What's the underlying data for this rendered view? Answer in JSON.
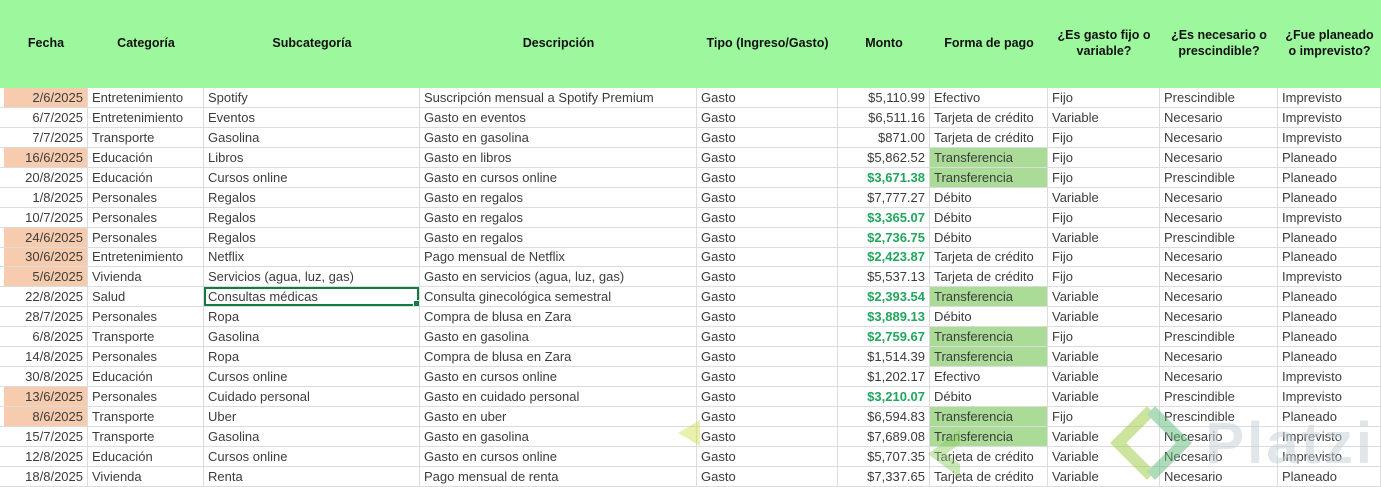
{
  "colors": {
    "header_bg": "#9df79d",
    "date_highlight_orange": "#f7ccae",
    "payment_highlight_green": "#aadb97",
    "amount_text_green": "#21a75d",
    "selection_border_green": "#107c41",
    "grid_line": "#dcdcdc",
    "watermark_text": "#c3cfd7",
    "watermark_logo_green": "#9ccb3f"
  },
  "watermark": {
    "brand": "Platzi"
  },
  "table": {
    "headers": [
      "Fecha",
      "Categoría",
      "Subcategoría",
      "Descripción",
      "Tipo (Ingreso/Gasto)",
      "Monto",
      "Forma de pago",
      "¿Es gasto fijo o variable?",
      "¿Es necesario o prescindible?",
      "¿Fue planeado o imprevisto?"
    ],
    "rows": [
      {
        "fecha": "2/6/2025",
        "fecha_hl": true,
        "categoria": "Entretenimiento",
        "subcategoria": "Spotify",
        "descripcion": "Suscripción mensual a Spotify Premium",
        "tipo": "Gasto",
        "monto": "$5,110.99",
        "monto_green": false,
        "pago": "Efectivo",
        "pago_hl": false,
        "fijo": "Fijo",
        "necesario": "Prescindible",
        "planeado": "Imprevisto"
      },
      {
        "fecha": "6/7/2025",
        "fecha_hl": false,
        "categoria": "Entretenimiento",
        "subcategoria": "Eventos",
        "descripcion": "Gasto en eventos",
        "tipo": "Gasto",
        "monto": "$6,511.16",
        "monto_green": false,
        "pago": "Tarjeta de crédito",
        "pago_hl": false,
        "fijo": "Variable",
        "necesario": "Necesario",
        "planeado": "Imprevisto"
      },
      {
        "fecha": "7/7/2025",
        "fecha_hl": false,
        "categoria": "Transporte",
        "subcategoria": "Gasolina",
        "descripcion": "Gasto en gasolina",
        "tipo": "Gasto",
        "monto": "$871.00",
        "monto_green": false,
        "pago": "Tarjeta de crédito",
        "pago_hl": false,
        "fijo": "Fijo",
        "necesario": "Necesario",
        "planeado": "Imprevisto"
      },
      {
        "fecha": "16/6/2025",
        "fecha_hl": true,
        "categoria": "Educación",
        "subcategoria": "Libros",
        "descripcion": "Gasto en libros",
        "tipo": "Gasto",
        "monto": "$5,862.52",
        "monto_green": false,
        "pago": "Transferencia",
        "pago_hl": true,
        "fijo": "Fijo",
        "necesario": "Necesario",
        "planeado": "Planeado"
      },
      {
        "fecha": "20/8/2025",
        "fecha_hl": false,
        "categoria": "Educación",
        "subcategoria": "Cursos online",
        "descripcion": "Gasto en cursos online",
        "tipo": "Gasto",
        "monto": "$3,671.38",
        "monto_green": true,
        "pago": "Transferencia",
        "pago_hl": true,
        "fijo": "Fijo",
        "necesario": "Prescindible",
        "planeado": "Planeado"
      },
      {
        "fecha": "1/8/2025",
        "fecha_hl": false,
        "categoria": "Personales",
        "subcategoria": "Regalos",
        "descripcion": "Gasto en regalos",
        "tipo": "Gasto",
        "monto": "$7,777.27",
        "monto_green": false,
        "pago": "Débito",
        "pago_hl": false,
        "fijo": "Variable",
        "necesario": "Necesario",
        "planeado": "Planeado"
      },
      {
        "fecha": "10/7/2025",
        "fecha_hl": false,
        "categoria": "Personales",
        "subcategoria": "Regalos",
        "descripcion": "Gasto en regalos",
        "tipo": "Gasto",
        "monto": "$3,365.07",
        "monto_green": true,
        "pago": "Débito",
        "pago_hl": false,
        "fijo": "Fijo",
        "necesario": "Necesario",
        "planeado": "Imprevisto"
      },
      {
        "fecha": "24/6/2025",
        "fecha_hl": true,
        "categoria": "Personales",
        "subcategoria": "Regalos",
        "descripcion": "Gasto en regalos",
        "tipo": "Gasto",
        "monto": "$2,736.75",
        "monto_green": true,
        "pago": "Débito",
        "pago_hl": false,
        "fijo": "Variable",
        "necesario": "Prescindible",
        "planeado": "Planeado"
      },
      {
        "fecha": "30/6/2025",
        "fecha_hl": true,
        "categoria": "Entretenimiento",
        "subcategoria": "Netflix",
        "descripcion": "Pago mensual de Netflix",
        "tipo": "Gasto",
        "monto": "$2,423.87",
        "monto_green": true,
        "pago": "Tarjeta de crédito",
        "pago_hl": false,
        "fijo": "Fijo",
        "necesario": "Necesario",
        "planeado": "Planeado"
      },
      {
        "fecha": "5/6/2025",
        "fecha_hl": true,
        "categoria": "Vivienda",
        "subcategoria": "Servicios (agua, luz, gas)",
        "descripcion": "Gasto en servicios (agua, luz, gas)",
        "tipo": "Gasto",
        "monto": "$5,537.13",
        "monto_green": false,
        "pago": "Tarjeta de crédito",
        "pago_hl": false,
        "fijo": "Fijo",
        "necesario": "Necesario",
        "planeado": "Imprevisto"
      },
      {
        "fecha": "22/8/2025",
        "fecha_hl": false,
        "categoria": "Salud",
        "subcategoria": "Consultas médicas",
        "descripcion": "Consulta ginecológica semestral",
        "tipo": "Gasto",
        "monto": "$2,393.54",
        "monto_green": true,
        "pago": "Transferencia",
        "pago_hl": true,
        "fijo": "Variable",
        "necesario": "Necesario",
        "planeado": "Planeado",
        "selected_cell": "subcategoria"
      },
      {
        "fecha": "28/7/2025",
        "fecha_hl": false,
        "categoria": "Personales",
        "subcategoria": "Ropa",
        "descripcion": "Compra de blusa en Zara",
        "tipo": "Gasto",
        "monto": "$3,889.13",
        "monto_green": true,
        "pago": "Débito",
        "pago_hl": false,
        "fijo": "Variable",
        "necesario": "Necesario",
        "planeado": "Planeado"
      },
      {
        "fecha": "6/8/2025",
        "fecha_hl": false,
        "categoria": "Transporte",
        "subcategoria": "Gasolina",
        "descripcion": "Gasto en gasolina",
        "tipo": "Gasto",
        "monto": "$2,759.67",
        "monto_green": true,
        "pago": "Transferencia",
        "pago_hl": true,
        "fijo": "Fijo",
        "necesario": "Prescindible",
        "planeado": "Planeado"
      },
      {
        "fecha": "14/8/2025",
        "fecha_hl": false,
        "categoria": "Personales",
        "subcategoria": "Ropa",
        "descripcion": "Compra de blusa en Zara",
        "tipo": "Gasto",
        "monto": "$1,514.39",
        "monto_green": false,
        "pago": "Transferencia",
        "pago_hl": true,
        "fijo": "Variable",
        "necesario": "Necesario",
        "planeado": "Planeado"
      },
      {
        "fecha": "30/8/2025",
        "fecha_hl": false,
        "categoria": "Educación",
        "subcategoria": "Cursos online",
        "descripcion": "Gasto en cursos online",
        "tipo": "Gasto",
        "monto": "$1,202.17",
        "monto_green": false,
        "pago": "Efectivo",
        "pago_hl": false,
        "fijo": "Variable",
        "necesario": "Necesario",
        "planeado": "Imprevisto"
      },
      {
        "fecha": "13/6/2025",
        "fecha_hl": true,
        "categoria": "Personales",
        "subcategoria": "Cuidado personal",
        "descripcion": "Gasto en cuidado personal",
        "tipo": "Gasto",
        "monto": "$3,210.07",
        "monto_green": true,
        "pago": "Débito",
        "pago_hl": false,
        "fijo": "Variable",
        "necesario": "Prescindible",
        "planeado": "Imprevisto"
      },
      {
        "fecha": "8/6/2025",
        "fecha_hl": true,
        "categoria": "Transporte",
        "subcategoria": "Uber",
        "descripcion": "Gasto en uber",
        "tipo": "Gasto",
        "monto": "$6,594.83",
        "monto_green": false,
        "pago": "Transferencia",
        "pago_hl": true,
        "fijo": "Fijo",
        "necesario": "Prescindible",
        "planeado": "Planeado"
      },
      {
        "fecha": "15/7/2025",
        "fecha_hl": false,
        "categoria": "Transporte",
        "subcategoria": "Gasolina",
        "descripcion": "Gasto en gasolina",
        "tipo": "Gasto",
        "monto": "$7,689.08",
        "monto_green": false,
        "pago": "Transferencia",
        "pago_hl": true,
        "fijo": "Variable",
        "necesario": "Necesario",
        "planeado": "Imprevisto"
      },
      {
        "fecha": "12/8/2025",
        "fecha_hl": false,
        "categoria": "Educación",
        "subcategoria": "Cursos online",
        "descripcion": "Gasto en cursos online",
        "tipo": "Gasto",
        "monto": "$5,707.35",
        "monto_green": false,
        "pago": "Tarjeta de crédito",
        "pago_hl": false,
        "fijo": "Variable",
        "necesario": "Necesario",
        "planeado": "Imprevisto"
      },
      {
        "fecha": "18/8/2025",
        "fecha_hl": false,
        "categoria": "Vivienda",
        "subcategoria": "Renta",
        "descripcion": "Pago mensual de renta",
        "tipo": "Gasto",
        "monto": "$7,337.65",
        "monto_green": false,
        "pago": "Tarjeta de crédito",
        "pago_hl": false,
        "fijo": "Variable",
        "necesario": "Necesario",
        "planeado": "Planeado"
      }
    ]
  }
}
